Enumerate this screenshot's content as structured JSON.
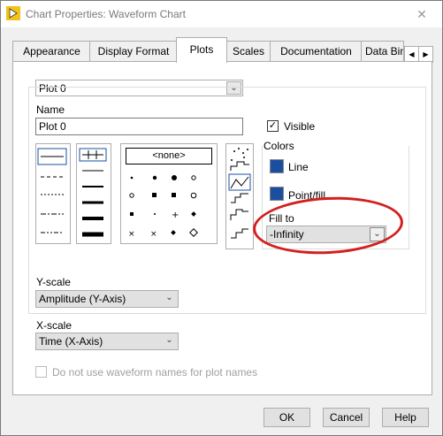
{
  "window": {
    "title": "Chart Properties: Waveform Chart",
    "close": "✕"
  },
  "tabs": [
    {
      "label": "Appearance"
    },
    {
      "label": "Display Format"
    },
    {
      "label": "Plots"
    },
    {
      "label": "Scales"
    },
    {
      "label": "Documentation"
    },
    {
      "label": "Data Bin"
    }
  ],
  "tab_scroll": {
    "left": "◀",
    "right": "▶"
  },
  "plot_selector": {
    "value": "Plot 0"
  },
  "name": {
    "label": "Name",
    "value": "Plot 0"
  },
  "visible": {
    "label": "Visible",
    "checked": true,
    "mark": "✓"
  },
  "point_style": {
    "none_label": "<none>"
  },
  "colors": {
    "label": "Colors",
    "line_label": "Line",
    "point_fill_label": "Point/fill",
    "line_color": "#1a4fa0",
    "point_fill_color": "#1a4fa0"
  },
  "fill_to": {
    "label": "Fill to",
    "value": "-Infinity",
    "highlight_color": "#d31f1f"
  },
  "y_scale": {
    "label": "Y-scale",
    "value": "Amplitude (Y-Axis)"
  },
  "x_scale": {
    "label": "X-scale",
    "value": "Time (X-Axis)"
  },
  "waveform_names": {
    "label": "Do not use waveform names for plot names",
    "checked": false
  },
  "buttons": {
    "ok": "OK",
    "cancel": "Cancel",
    "help": "Help"
  },
  "combo_arrow": "⌄"
}
